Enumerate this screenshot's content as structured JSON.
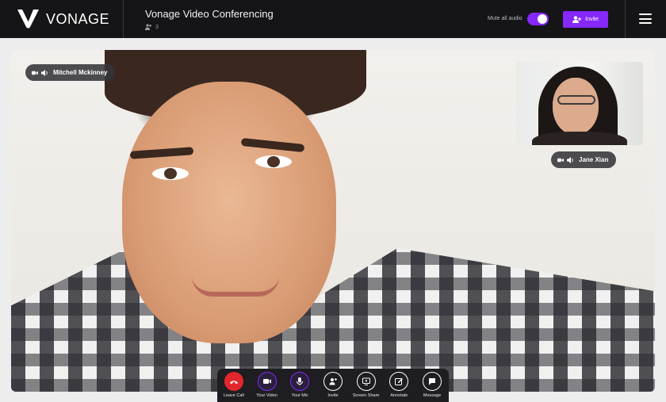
{
  "brand": {
    "name": "VONAGE"
  },
  "meeting": {
    "title": "Vonage Video Conferencing",
    "participants": "3"
  },
  "header": {
    "mute_all_label": "Mute all audio",
    "mute_all_on": true,
    "invite_label": "Invite"
  },
  "video": {
    "main_participant": "Mitchell Mckinney",
    "pip_participant": "Jane Xian"
  },
  "controls": [
    {
      "label": "Leave Call",
      "icon": "phone-hangup-icon"
    },
    {
      "label": "Your Video",
      "icon": "video-camera-icon"
    },
    {
      "label": "Your Mic",
      "icon": "microphone-icon"
    },
    {
      "label": "Invite",
      "icon": "add-user-icon"
    },
    {
      "label": "Screen Share",
      "icon": "screen-share-icon"
    },
    {
      "label": "Annotate",
      "icon": "annotate-icon"
    },
    {
      "label": "Message",
      "icon": "message-icon"
    }
  ],
  "colors": {
    "accent": "#8728fb",
    "danger": "#e2262b",
    "topbar": "#151518"
  }
}
